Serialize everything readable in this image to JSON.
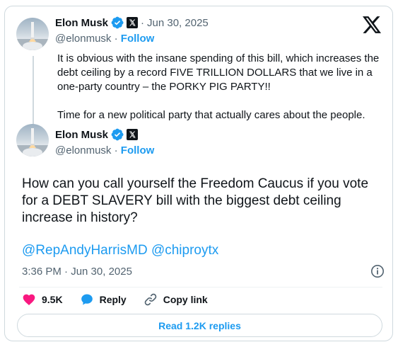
{
  "quoted_tweet": {
    "author_name": "Elon Musk",
    "handle": "@elonmusk",
    "follow_label": "Follow",
    "separator": "·",
    "date": "Jun 30, 2025",
    "paragraphs": [
      "It is obvious with the insane spending of this bill, which increases the debt ceiling by a record FIVE TRILLION DOLLARS that we live in a one-party country – the PORKY PIG PARTY!!",
      "Time for a new political party that actually cares about the people."
    ]
  },
  "tweet": {
    "author_name": "Elon Musk",
    "handle": "@elonmusk",
    "follow_label": "Follow",
    "separator": "·",
    "text": "How can you call yourself the Freedom Caucus if you vote for a DEBT SLAVERY bill with the biggest debt ceiling increase in history?",
    "mentions": [
      "@RepAndyHarrisMD",
      "@chiproytx"
    ],
    "timestamp": "3:36 PM · Jun 30, 2025"
  },
  "actions": {
    "likes": "9.5K",
    "reply_label": "Reply",
    "copy_link_label": "Copy link"
  },
  "read_replies_label": "Read 1.2K replies",
  "icons": [
    "x-logo-icon",
    "verified-badge-icon",
    "x-affiliation-icon",
    "info-icon",
    "heart-icon",
    "reply-icon",
    "link-icon"
  ],
  "colors": {
    "accent": "#1d9bf0",
    "like": "#f91880",
    "text": "#0f1419",
    "secondary_text": "#536471",
    "border": "#cfd9de"
  }
}
